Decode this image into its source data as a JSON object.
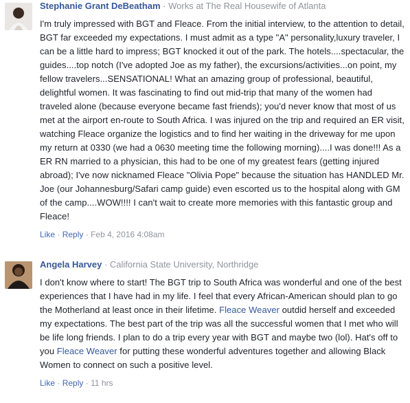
{
  "comments": [
    {
      "name": "Stephanie Grant DeBeatham",
      "work": "Works at The Real Housewife of Atlanta",
      "text": "I'm truly impressed with BGT and Fleace. From the initial interview, to the attention to detail, BGT far exceeded my expectations. I must admit as a type \"A\" personality,luxury traveler, I can be a little hard to impress; BGT knocked it out of the park. The hotels....spectacular, the guides....top notch (I've adopted Joe as my father), the excursions/activities...on point, my fellow travelers...SENSATIONAL! What an amazing group of professional, beautiful, delightful women. It was fascinating to find out mid-trip that many of the women had traveled alone (because everyone became fast friends); you'd never know that most of us met at the airport en-route to South Africa. I was injured on the trip and required an ER visit, watching Fleace organize the logistics and to find her waiting in the driveway for me upon my return at 0330 (we had a 0630 meeting time the following morning)....I was done!!! As a ER RN married to a physician, this had to be one of my greatest fears (getting injured abroad); I've now nicknamed Fleace \"Olivia Pope\" because the situation has HANDLED Mr. Joe (our Johannesburg/Safari camp guide) even escorted us to the hospital along with GM of the camp....WOW!!!! I can't wait to create more memories with this fantastic group and Fleace!",
      "like": "Like",
      "dot": "·",
      "reply": "Reply",
      "time": "Feb 4, 2016 4:08am"
    },
    {
      "name": "Angela Harvey",
      "work": "California State University, Northridge",
      "text_1": "I don't know where to start! The BGT trip to South Africa was wonderful and one of the best experiences that I have had in my life. I feel that every African-American should plan to go the Motherland at least once in their lifetime. ",
      "link_1": "Fleace Weaver",
      "text_2": " outdid herself and exceeded my expectations. The best part of the trip was all the successful women that I met who will be life long friends. I plan to do a trip every year with BGT and maybe two (lol). Hat's off to you ",
      "link_2": "Fleace Weaver",
      "text_3": " for putting these wonderful adventures together and allowing Black Women to connect on such a positive level.",
      "like": "Like",
      "dot": "·",
      "reply": "Reply",
      "time": "11 hrs"
    }
  ]
}
